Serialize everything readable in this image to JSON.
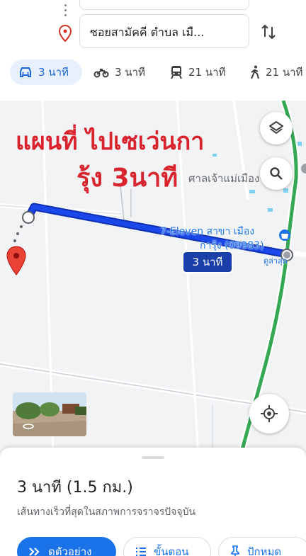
{
  "search": {
    "destination_value": "ซอยสามัคคี ตำบล เมื..."
  },
  "modes": [
    {
      "icon": "car-icon",
      "label": "3 นาที",
      "active": true
    },
    {
      "icon": "motorcycle-icon",
      "label": "3 นาที"
    },
    {
      "icon": "transit-icon",
      "label": "21 นาที"
    },
    {
      "icon": "walk-icon",
      "label": "21 นาที"
    }
  ],
  "map": {
    "overlay_line1": "แผนที่ ไปเซเว่นกา",
    "overlay_line2": "รุ้ง 3นาที",
    "shrine_label": "ศาลเจ้าแม่เมือง",
    "poi_label_1": "7-Eleven สาขา เมือง",
    "poi_label_2": "การุ้ง (09983)",
    "poi_sub_label": "ดูล่าสุด",
    "route_time_badge": "3 นาที"
  },
  "sheet": {
    "duration": "3 นาที (1.5 กม.)",
    "subtitle": "เส้นทางเร็วที่สุดในสภาพการจราจรปัจจุบัน",
    "preview_button": "ดูตัวอย่าง",
    "steps_button": "ขั้นตอน",
    "pin_button": "ปักหมุด"
  },
  "colors": {
    "route": "#1a47e8",
    "accent": "#1a73e8",
    "overlay_text": "#d9232d",
    "main_road": "#34a853"
  }
}
